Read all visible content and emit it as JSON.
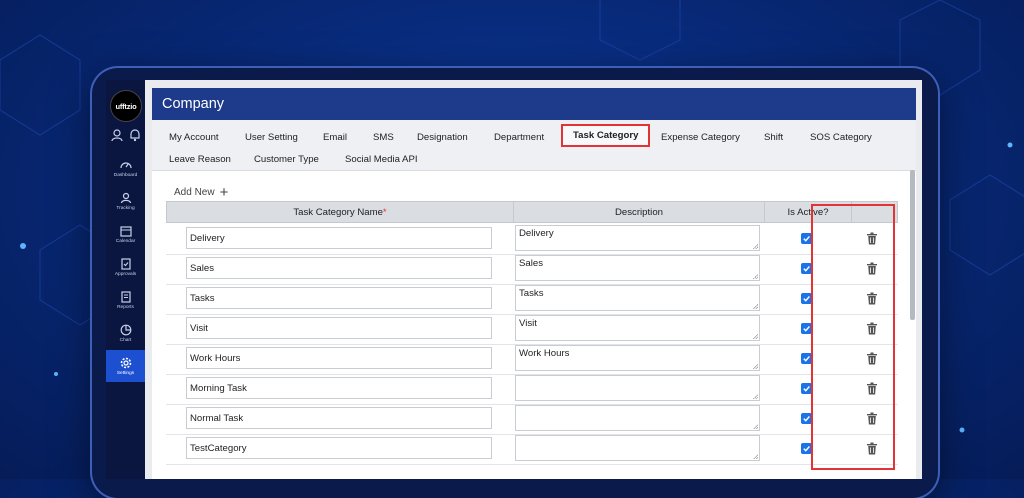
{
  "app": {
    "logo_text": "ufftzio",
    "page_title": "Company"
  },
  "sidebar": {
    "items": [
      {
        "label": "Dashboard",
        "icon": "gauge-icon"
      },
      {
        "label": "Tracking",
        "icon": "tracking-icon"
      },
      {
        "label": "Calendar",
        "icon": "calendar-icon"
      },
      {
        "label": "Approvals",
        "icon": "approvals-icon"
      },
      {
        "label": "Reports",
        "icon": "reports-icon"
      },
      {
        "label": "Chart",
        "icon": "pie-chart-icon"
      },
      {
        "label": "Settings",
        "icon": "gear-icon",
        "active": true
      }
    ]
  },
  "tabs": {
    "row1": [
      "My Account",
      "User Setting",
      "Email",
      "SMS",
      "Designation",
      "Department",
      "Task Category",
      "Expense Category",
      "Shift",
      "SOS Category"
    ],
    "row2": [
      "Leave Reason",
      "Customer Type",
      "Social Media API"
    ],
    "active": "Task Category"
  },
  "toolbar": {
    "add_new_label": "Add New",
    "add_icon": "plus-icon"
  },
  "table": {
    "headers": {
      "name": "Task Category Name",
      "required_mark": "*",
      "description": "Description",
      "active": "Is Active?"
    },
    "rows": [
      {
        "name": "Delivery",
        "description": "Delivery",
        "active": true
      },
      {
        "name": "Sales",
        "description": "Sales",
        "active": true
      },
      {
        "name": "Tasks",
        "description": "Tasks",
        "active": true
      },
      {
        "name": "Visit",
        "description": "Visit",
        "active": true
      },
      {
        "name": "Work Hours",
        "description": "Work Hours",
        "active": true
      },
      {
        "name": "Morning Task",
        "description": "",
        "active": true
      },
      {
        "name": "Normal Task",
        "description": "",
        "active": true
      },
      {
        "name": "TestCategory",
        "description": "",
        "active": true
      }
    ]
  },
  "colors": {
    "accent": "#1e3a8a",
    "highlight": "#e23434",
    "checkbox": "#1a73e8",
    "sidebar": "#0b1640"
  }
}
